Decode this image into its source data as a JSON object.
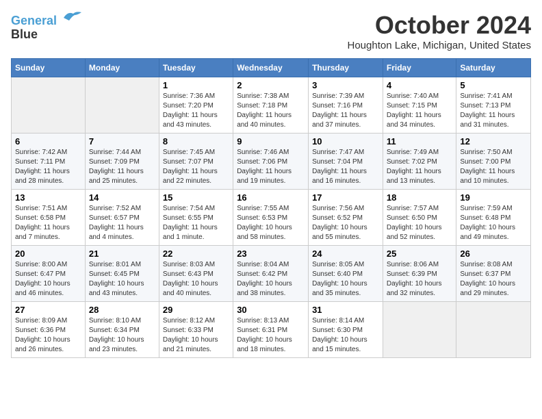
{
  "header": {
    "logo_line1": "General",
    "logo_line2": "Blue",
    "month": "October 2024",
    "location": "Houghton Lake, Michigan, United States"
  },
  "days_of_week": [
    "Sunday",
    "Monday",
    "Tuesday",
    "Wednesday",
    "Thursday",
    "Friday",
    "Saturday"
  ],
  "weeks": [
    [
      {
        "day": "",
        "sunrise": "",
        "sunset": "",
        "daylight": ""
      },
      {
        "day": "",
        "sunrise": "",
        "sunset": "",
        "daylight": ""
      },
      {
        "day": "1",
        "sunrise": "Sunrise: 7:36 AM",
        "sunset": "Sunset: 7:20 PM",
        "daylight": "Daylight: 11 hours and 43 minutes."
      },
      {
        "day": "2",
        "sunrise": "Sunrise: 7:38 AM",
        "sunset": "Sunset: 7:18 PM",
        "daylight": "Daylight: 11 hours and 40 minutes."
      },
      {
        "day": "3",
        "sunrise": "Sunrise: 7:39 AM",
        "sunset": "Sunset: 7:16 PM",
        "daylight": "Daylight: 11 hours and 37 minutes."
      },
      {
        "day": "4",
        "sunrise": "Sunrise: 7:40 AM",
        "sunset": "Sunset: 7:15 PM",
        "daylight": "Daylight: 11 hours and 34 minutes."
      },
      {
        "day": "5",
        "sunrise": "Sunrise: 7:41 AM",
        "sunset": "Sunset: 7:13 PM",
        "daylight": "Daylight: 11 hours and 31 minutes."
      }
    ],
    [
      {
        "day": "6",
        "sunrise": "Sunrise: 7:42 AM",
        "sunset": "Sunset: 7:11 PM",
        "daylight": "Daylight: 11 hours and 28 minutes."
      },
      {
        "day": "7",
        "sunrise": "Sunrise: 7:44 AM",
        "sunset": "Sunset: 7:09 PM",
        "daylight": "Daylight: 11 hours and 25 minutes."
      },
      {
        "day": "8",
        "sunrise": "Sunrise: 7:45 AM",
        "sunset": "Sunset: 7:07 PM",
        "daylight": "Daylight: 11 hours and 22 minutes."
      },
      {
        "day": "9",
        "sunrise": "Sunrise: 7:46 AM",
        "sunset": "Sunset: 7:06 PM",
        "daylight": "Daylight: 11 hours and 19 minutes."
      },
      {
        "day": "10",
        "sunrise": "Sunrise: 7:47 AM",
        "sunset": "Sunset: 7:04 PM",
        "daylight": "Daylight: 11 hours and 16 minutes."
      },
      {
        "day": "11",
        "sunrise": "Sunrise: 7:49 AM",
        "sunset": "Sunset: 7:02 PM",
        "daylight": "Daylight: 11 hours and 13 minutes."
      },
      {
        "day": "12",
        "sunrise": "Sunrise: 7:50 AM",
        "sunset": "Sunset: 7:00 PM",
        "daylight": "Daylight: 11 hours and 10 minutes."
      }
    ],
    [
      {
        "day": "13",
        "sunrise": "Sunrise: 7:51 AM",
        "sunset": "Sunset: 6:58 PM",
        "daylight": "Daylight: 11 hours and 7 minutes."
      },
      {
        "day": "14",
        "sunrise": "Sunrise: 7:52 AM",
        "sunset": "Sunset: 6:57 PM",
        "daylight": "Daylight: 11 hours and 4 minutes."
      },
      {
        "day": "15",
        "sunrise": "Sunrise: 7:54 AM",
        "sunset": "Sunset: 6:55 PM",
        "daylight": "Daylight: 11 hours and 1 minute."
      },
      {
        "day": "16",
        "sunrise": "Sunrise: 7:55 AM",
        "sunset": "Sunset: 6:53 PM",
        "daylight": "Daylight: 10 hours and 58 minutes."
      },
      {
        "day": "17",
        "sunrise": "Sunrise: 7:56 AM",
        "sunset": "Sunset: 6:52 PM",
        "daylight": "Daylight: 10 hours and 55 minutes."
      },
      {
        "day": "18",
        "sunrise": "Sunrise: 7:57 AM",
        "sunset": "Sunset: 6:50 PM",
        "daylight": "Daylight: 10 hours and 52 minutes."
      },
      {
        "day": "19",
        "sunrise": "Sunrise: 7:59 AM",
        "sunset": "Sunset: 6:48 PM",
        "daylight": "Daylight: 10 hours and 49 minutes."
      }
    ],
    [
      {
        "day": "20",
        "sunrise": "Sunrise: 8:00 AM",
        "sunset": "Sunset: 6:47 PM",
        "daylight": "Daylight: 10 hours and 46 minutes."
      },
      {
        "day": "21",
        "sunrise": "Sunrise: 8:01 AM",
        "sunset": "Sunset: 6:45 PM",
        "daylight": "Daylight: 10 hours and 43 minutes."
      },
      {
        "day": "22",
        "sunrise": "Sunrise: 8:03 AM",
        "sunset": "Sunset: 6:43 PM",
        "daylight": "Daylight: 10 hours and 40 minutes."
      },
      {
        "day": "23",
        "sunrise": "Sunrise: 8:04 AM",
        "sunset": "Sunset: 6:42 PM",
        "daylight": "Daylight: 10 hours and 38 minutes."
      },
      {
        "day": "24",
        "sunrise": "Sunrise: 8:05 AM",
        "sunset": "Sunset: 6:40 PM",
        "daylight": "Daylight: 10 hours and 35 minutes."
      },
      {
        "day": "25",
        "sunrise": "Sunrise: 8:06 AM",
        "sunset": "Sunset: 6:39 PM",
        "daylight": "Daylight: 10 hours and 32 minutes."
      },
      {
        "day": "26",
        "sunrise": "Sunrise: 8:08 AM",
        "sunset": "Sunset: 6:37 PM",
        "daylight": "Daylight: 10 hours and 29 minutes."
      }
    ],
    [
      {
        "day": "27",
        "sunrise": "Sunrise: 8:09 AM",
        "sunset": "Sunset: 6:36 PM",
        "daylight": "Daylight: 10 hours and 26 minutes."
      },
      {
        "day": "28",
        "sunrise": "Sunrise: 8:10 AM",
        "sunset": "Sunset: 6:34 PM",
        "daylight": "Daylight: 10 hours and 23 minutes."
      },
      {
        "day": "29",
        "sunrise": "Sunrise: 8:12 AM",
        "sunset": "Sunset: 6:33 PM",
        "daylight": "Daylight: 10 hours and 21 minutes."
      },
      {
        "day": "30",
        "sunrise": "Sunrise: 8:13 AM",
        "sunset": "Sunset: 6:31 PM",
        "daylight": "Daylight: 10 hours and 18 minutes."
      },
      {
        "day": "31",
        "sunrise": "Sunrise: 8:14 AM",
        "sunset": "Sunset: 6:30 PM",
        "daylight": "Daylight: 10 hours and 15 minutes."
      },
      {
        "day": "",
        "sunrise": "",
        "sunset": "",
        "daylight": ""
      },
      {
        "day": "",
        "sunrise": "",
        "sunset": "",
        "daylight": ""
      }
    ]
  ]
}
